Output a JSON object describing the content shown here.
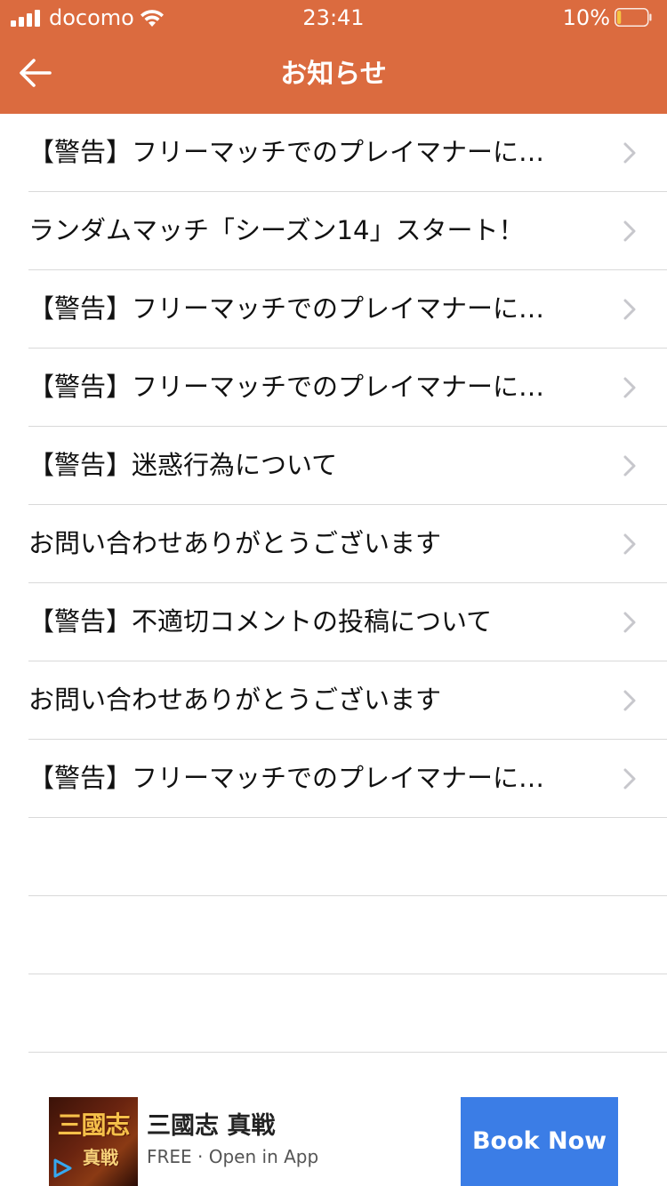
{
  "status_bar": {
    "carrier": "docomo",
    "time": "23:41",
    "battery_percent": "10%",
    "battery_level": 0.1,
    "battery_color": "#f5c542",
    "icons": [
      "signal-icon",
      "wifi-icon",
      "battery-icon"
    ]
  },
  "nav": {
    "title": "お知らせ",
    "back_icon": "back-arrow-icon"
  },
  "notices": [
    {
      "label": "【警告】フリーマッチでのプレイマナーに…"
    },
    {
      "label": "ランダムマッチ「シーズン14」スタート！"
    },
    {
      "label": "【警告】フリーマッチでのプレイマナーに…"
    },
    {
      "label": "【警告】フリーマッチでのプレイマナーに…"
    },
    {
      "label": "【警告】迷惑行為について"
    },
    {
      "label": "お問い合わせありがとうございます"
    },
    {
      "label": "【警告】不適切コメントの投稿について"
    },
    {
      "label": "お問い合わせありがとうございます"
    },
    {
      "label": "【警告】フリーマッチでのプレイマナーに…"
    }
  ],
  "ad": {
    "app_icon_text": "三國志",
    "app_icon_subtext": "真戦",
    "title": "三國志 真戦",
    "subtitle": "FREE · Open in App",
    "button_label": "Book Now"
  },
  "colors": {
    "header": "#db6b3f",
    "divider": "#d9d9d9",
    "chevron": "#c7c7cc",
    "ad_button": "#3b7de6"
  }
}
